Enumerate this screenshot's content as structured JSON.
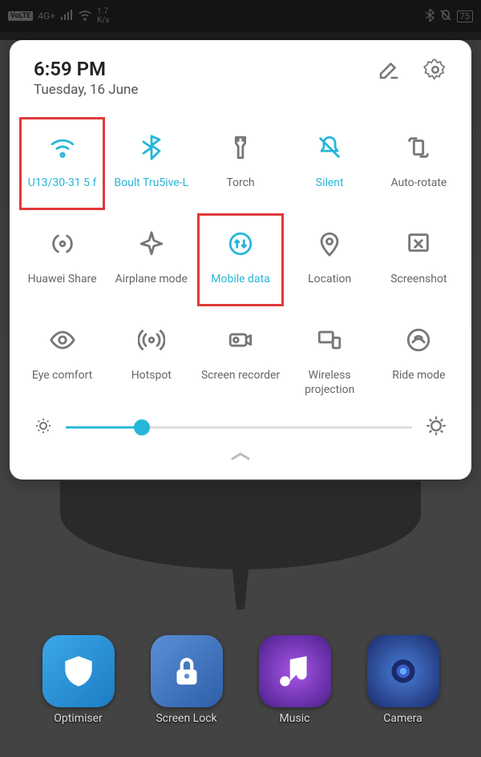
{
  "statusbar": {
    "volte": "VoLTE",
    "network": "4G+",
    "speed_top": "1.7",
    "speed_bot": "K/s",
    "battery": "75"
  },
  "panel": {
    "time": "6:59 PM",
    "date": "Tuesday, 16 June"
  },
  "tiles": [
    {
      "label": "U13/30-31 5 f",
      "active": true,
      "icon": "wifi",
      "highlight": true
    },
    {
      "label": "Boult Tru5ive-L",
      "active": true,
      "icon": "bluetooth",
      "highlight": false
    },
    {
      "label": "Torch",
      "active": false,
      "icon": "torch",
      "highlight": false
    },
    {
      "label": "Silent",
      "active": true,
      "icon": "silent",
      "highlight": false
    },
    {
      "label": "Auto-rotate",
      "active": false,
      "icon": "rotate",
      "highlight": false
    },
    {
      "label": "Huawei Share",
      "active": false,
      "icon": "share",
      "highlight": false
    },
    {
      "label": "Airplane mode",
      "active": false,
      "icon": "airplane",
      "highlight": false
    },
    {
      "label": "Mobile data",
      "active": true,
      "icon": "mobiledata",
      "highlight": true
    },
    {
      "label": "Location",
      "active": false,
      "icon": "location",
      "highlight": false
    },
    {
      "label": "Screenshot",
      "active": false,
      "icon": "screenshot",
      "highlight": false
    },
    {
      "label": "Eye comfort",
      "active": false,
      "icon": "eye",
      "highlight": false
    },
    {
      "label": "Hotspot",
      "active": false,
      "icon": "hotspot",
      "highlight": false
    },
    {
      "label": "Screen recorder",
      "active": false,
      "icon": "recorder",
      "highlight": false
    },
    {
      "label": "Wireless projection",
      "active": false,
      "icon": "projection",
      "highlight": false
    },
    {
      "label": "Ride mode",
      "active": false,
      "icon": "ride",
      "highlight": false
    }
  ],
  "brightness": {
    "value": 22
  },
  "dock": [
    {
      "label": "Optimiser",
      "icon": "shield",
      "class": "ai1"
    },
    {
      "label": "Screen Lock",
      "icon": "lock",
      "class": "ai2"
    },
    {
      "label": "Music",
      "icon": "music",
      "class": "ai3"
    },
    {
      "label": "Camera",
      "icon": "camera",
      "class": "ai4"
    }
  ]
}
